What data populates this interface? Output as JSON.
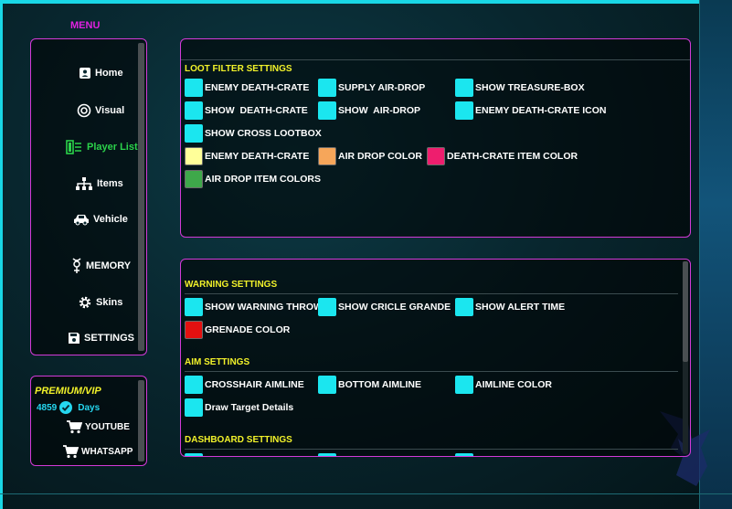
{
  "menu": {
    "title": "MENU",
    "items": [
      {
        "label": "Home",
        "icon": "user-card-icon"
      },
      {
        "label": "Visual",
        "icon": "target-icon"
      },
      {
        "label": "Player List",
        "icon": "player-list-icon",
        "active": true
      },
      {
        "label": "Items",
        "icon": "sitemap-icon"
      },
      {
        "label": "Vehicle",
        "icon": "car-icon"
      },
      {
        "label": "MEMORY",
        "icon": "mercury-icon"
      },
      {
        "label": "Skins",
        "icon": "cog-icon"
      },
      {
        "label": "SETTINGS",
        "icon": "floppy-disk-icon"
      }
    ]
  },
  "premium": {
    "label": "PREMIUM/VIP",
    "days_count": "4859",
    "days_label": "Days",
    "youtube": "YOUTUBE",
    "whatsapp": "WHATSAPP"
  },
  "loot": {
    "title": "LOOT FILTER SETTINGS",
    "options": [
      "ENEMY DEATH-CRATE",
      "SUPPLY AIR-DROP",
      "SHOW TREASURE-BOX",
      "SHOW  DEATH-CRATE",
      "SHOW  AIR-DROP",
      "ENEMY DEATH-CRATE ICON",
      "SHOW CROSS LOOTBOX"
    ],
    "colors": [
      {
        "label": "ENEMY DEATH-CRATE",
        "color": "#ffff99"
      },
      {
        "label": "AIR DROP COLOR",
        "color": "#f6a65a"
      },
      {
        "label": "DEATH-CRATE ITEM COLOR",
        "color": "#ee1e6e"
      },
      {
        "label": "AIR DROP ITEM COLORS",
        "color": "#3ea84a"
      }
    ]
  },
  "warning": {
    "title": "WARNING SETTINGS",
    "options": [
      "SHOW WARNING THROW",
      "SHOW CRICLE GRANDE",
      "SHOW ALERT TIME"
    ],
    "grenade": {
      "label": "GRENADE COLOR",
      "color": "#e41010"
    }
  },
  "aim": {
    "title": "AIM SETTINGS",
    "options": [
      "CROSSHAIR AIMLINE",
      "BOTTOM AIMLINE",
      "AIMLINE COLOR",
      "Draw Target Details"
    ]
  },
  "dashboard": {
    "title": "DASHBOARD SETTINGS"
  },
  "colors": {
    "accent_cyan": "#1be6ef",
    "border_magenta": "#d33ad8",
    "section_yellow": "#f2f22a",
    "active_green": "#2bd24a"
  }
}
